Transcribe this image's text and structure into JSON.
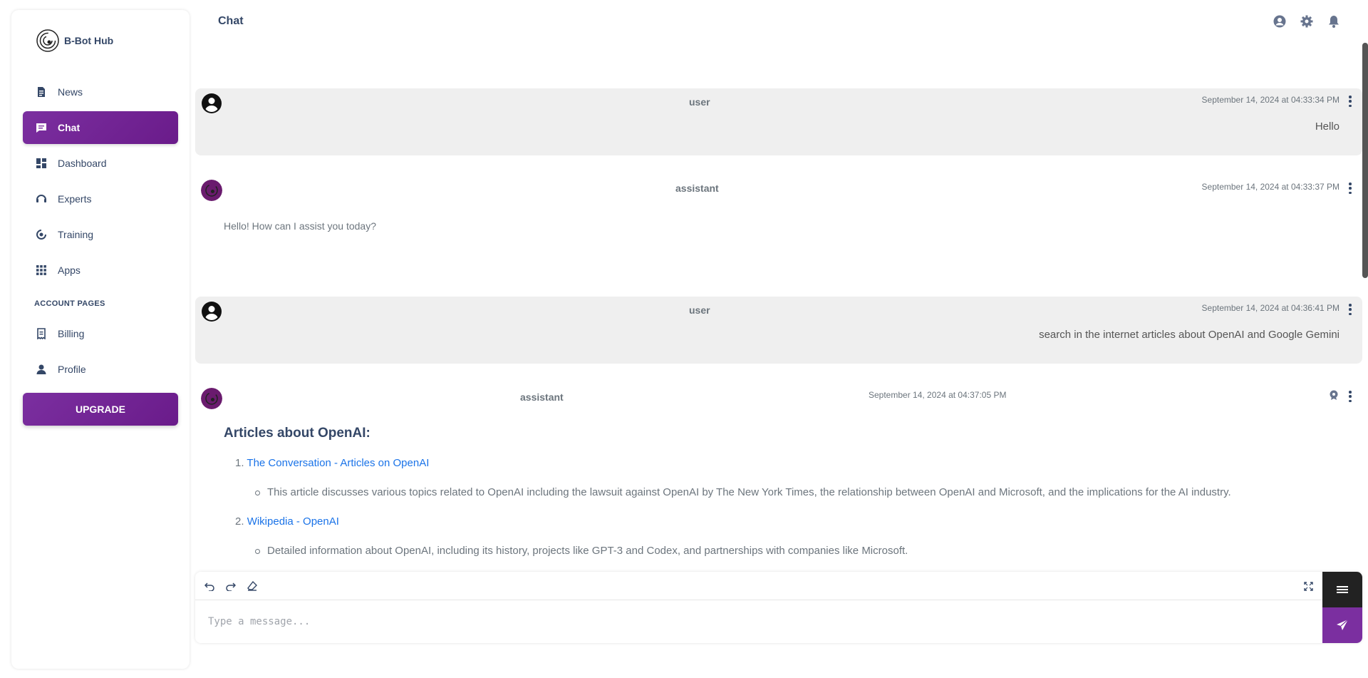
{
  "brand": {
    "name": "B-Bot Hub"
  },
  "header": {
    "title": "Chat"
  },
  "sidebar": {
    "items": [
      {
        "label": "News",
        "icon": "news-icon"
      },
      {
        "label": "Chat",
        "icon": "chat-icon",
        "active": true
      },
      {
        "label": "Dashboard",
        "icon": "dashboard-icon"
      },
      {
        "label": "Experts",
        "icon": "experts-icon"
      },
      {
        "label": "Training",
        "icon": "training-icon"
      },
      {
        "label": "Apps",
        "icon": "apps-icon"
      }
    ],
    "section_label": "ACCOUNT PAGES",
    "account_items": [
      {
        "label": "Billing",
        "icon": "billing-icon"
      },
      {
        "label": "Profile",
        "icon": "profile-icon"
      }
    ],
    "upgrade_label": "UPGRADE"
  },
  "messages": [
    {
      "role": "user",
      "timestamp": "September 14, 2024 at 04:33:34 PM",
      "text": "Hello"
    },
    {
      "role": "assistant",
      "timestamp": "September 14, 2024 at 04:33:37 PM",
      "text": "Hello! How can I assist you today?"
    },
    {
      "role": "user",
      "timestamp": "September 14, 2024 at 04:36:41 PM",
      "text": "search in the internet articles about OpenAI and Google Gemini"
    },
    {
      "role": "assistant",
      "timestamp": "September 14, 2024 at 04:37:05 PM",
      "heading": "Articles about OpenAI:",
      "items": [
        {
          "num": "1.",
          "title": "The Conversation - Articles on OpenAI",
          "desc": "This article discusses various topics related to OpenAI including the lawsuit against OpenAI by The New York Times, the relationship between OpenAI and Microsoft, and the implications for the AI industry."
        },
        {
          "num": "2.",
          "title": "Wikipedia - OpenAI",
          "desc": "Detailed information about OpenAI, including its history, projects like GPT-3 and Codex, and partnerships with companies like Microsoft."
        }
      ]
    }
  ],
  "composer": {
    "placeholder": "Type a message..."
  },
  "colors": {
    "accent": "#7b2fa0",
    "link": "#1a73e8",
    "user_bg": "#efefef"
  }
}
